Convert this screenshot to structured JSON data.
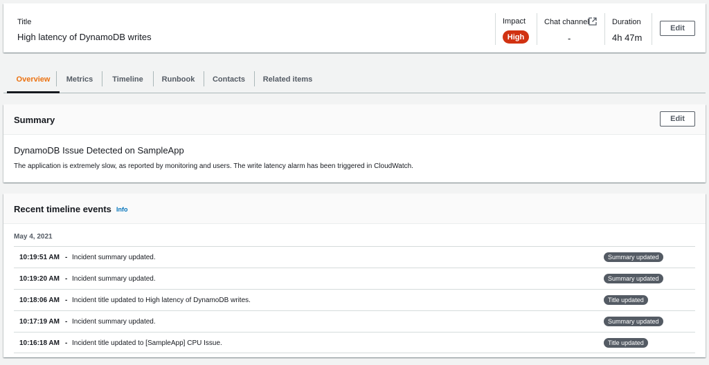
{
  "incident": {
    "title_label": "Title",
    "title_value": "High latency of DynamoDB writes",
    "impact_label": "Impact",
    "impact_value": "High",
    "chat_label": "Chat channel",
    "chat_value": "-",
    "duration_label": "Duration",
    "duration_value": "4h 47m",
    "edit_label": "Edit"
  },
  "tabs": [
    {
      "label": "Overview"
    },
    {
      "label": "Metrics"
    },
    {
      "label": "Timeline"
    },
    {
      "label": "Runbook"
    },
    {
      "label": "Contacts"
    },
    {
      "label": "Related items"
    }
  ],
  "summary": {
    "title": "Summary",
    "edit_label": "Edit",
    "heading": "DynamoDB Issue Detected on SampleApp",
    "text": "The application is extremely slow, as reported by monitoring and users. The write latency alarm has been triggered in CloudWatch."
  },
  "timeline": {
    "title": "Recent timeline events",
    "info_label": "Info",
    "date": "May 4, 2021",
    "dash": "-",
    "events": [
      {
        "time": "10:19:51 AM",
        "text": "Incident summary updated.",
        "badge": "Summary updated"
      },
      {
        "time": "10:19:20 AM",
        "text": "Incident summary updated.",
        "badge": "Summary updated"
      },
      {
        "time": "10:18:06 AM",
        "text": "Incident title updated to High latency of DynamoDB writes.",
        "badge": "Title updated"
      },
      {
        "time": "10:17:19 AM",
        "text": "Incident summary updated.",
        "badge": "Summary updated"
      },
      {
        "time": "10:16:18 AM",
        "text": "Incident title updated to [SampleApp] CPU Issue.",
        "badge": "Title updated"
      }
    ]
  },
  "colors": {
    "accent": "#ec7211",
    "danger": "#d13212",
    "link": "#0073bb",
    "badge": "#545b64"
  }
}
